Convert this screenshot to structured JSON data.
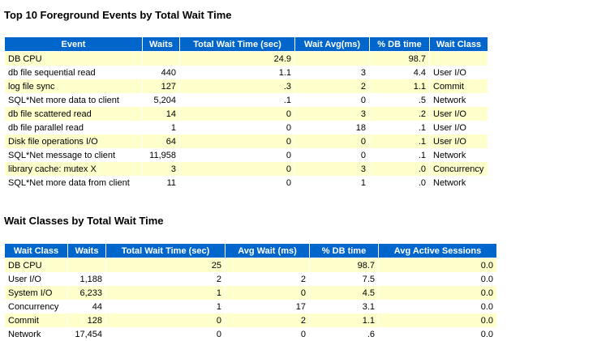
{
  "foreground_events": {
    "title": "Top 10 Foreground Events by Total Wait Time",
    "headers": [
      "Event",
      "Waits",
      "Total Wait Time (sec)",
      "Wait Avg(ms)",
      "% DB time",
      "Wait Class"
    ],
    "rows": [
      [
        "DB CPU",
        "",
        "24.9",
        "",
        "98.7",
        ""
      ],
      [
        "db file sequential read",
        "440",
        "1.1",
        "3",
        "4.4",
        "User I/O"
      ],
      [
        "log file sync",
        "127",
        ".3",
        "2",
        "1.1",
        "Commit"
      ],
      [
        "SQL*Net more data to client",
        "5,204",
        ".1",
        "0",
        ".5",
        "Network"
      ],
      [
        "db file scattered read",
        "14",
        "0",
        "3",
        ".2",
        "User I/O"
      ],
      [
        "db file parallel read",
        "1",
        "0",
        "18",
        ".1",
        "User I/O"
      ],
      [
        "Disk file operations I/O",
        "64",
        "0",
        "0",
        ".1",
        "User I/O"
      ],
      [
        "SQL*Net message to client",
        "11,958",
        "0",
        "0",
        ".1",
        "Network"
      ],
      [
        "library cache: mutex X",
        "3",
        "0",
        "3",
        ".0",
        "Concurrency"
      ],
      [
        "SQL*Net more data from client",
        "11",
        "0",
        "1",
        ".0",
        "Network"
      ]
    ]
  },
  "wait_classes": {
    "title": "Wait Classes by Total Wait Time",
    "headers": [
      "Wait Class",
      "Waits",
      "Total Wait Time (sec)",
      "Avg Wait (ms)",
      "% DB time",
      "Avg Active Sessions"
    ],
    "rows": [
      [
        "DB CPU",
        "",
        "25",
        "",
        "98.7",
        "0.0"
      ],
      [
        "User I/O",
        "1,188",
        "2",
        "2",
        "7.5",
        "0.0"
      ],
      [
        "System I/O",
        "6,233",
        "1",
        "0",
        "4.5",
        "0.0"
      ],
      [
        "Concurrency",
        "44",
        "1",
        "17",
        "3.1",
        "0.0"
      ],
      [
        "Commit",
        "128",
        "0",
        "2",
        "1.1",
        "0.0"
      ],
      [
        "Network",
        "17,454",
        "0",
        "0",
        ".6",
        "0.0"
      ]
    ]
  }
}
